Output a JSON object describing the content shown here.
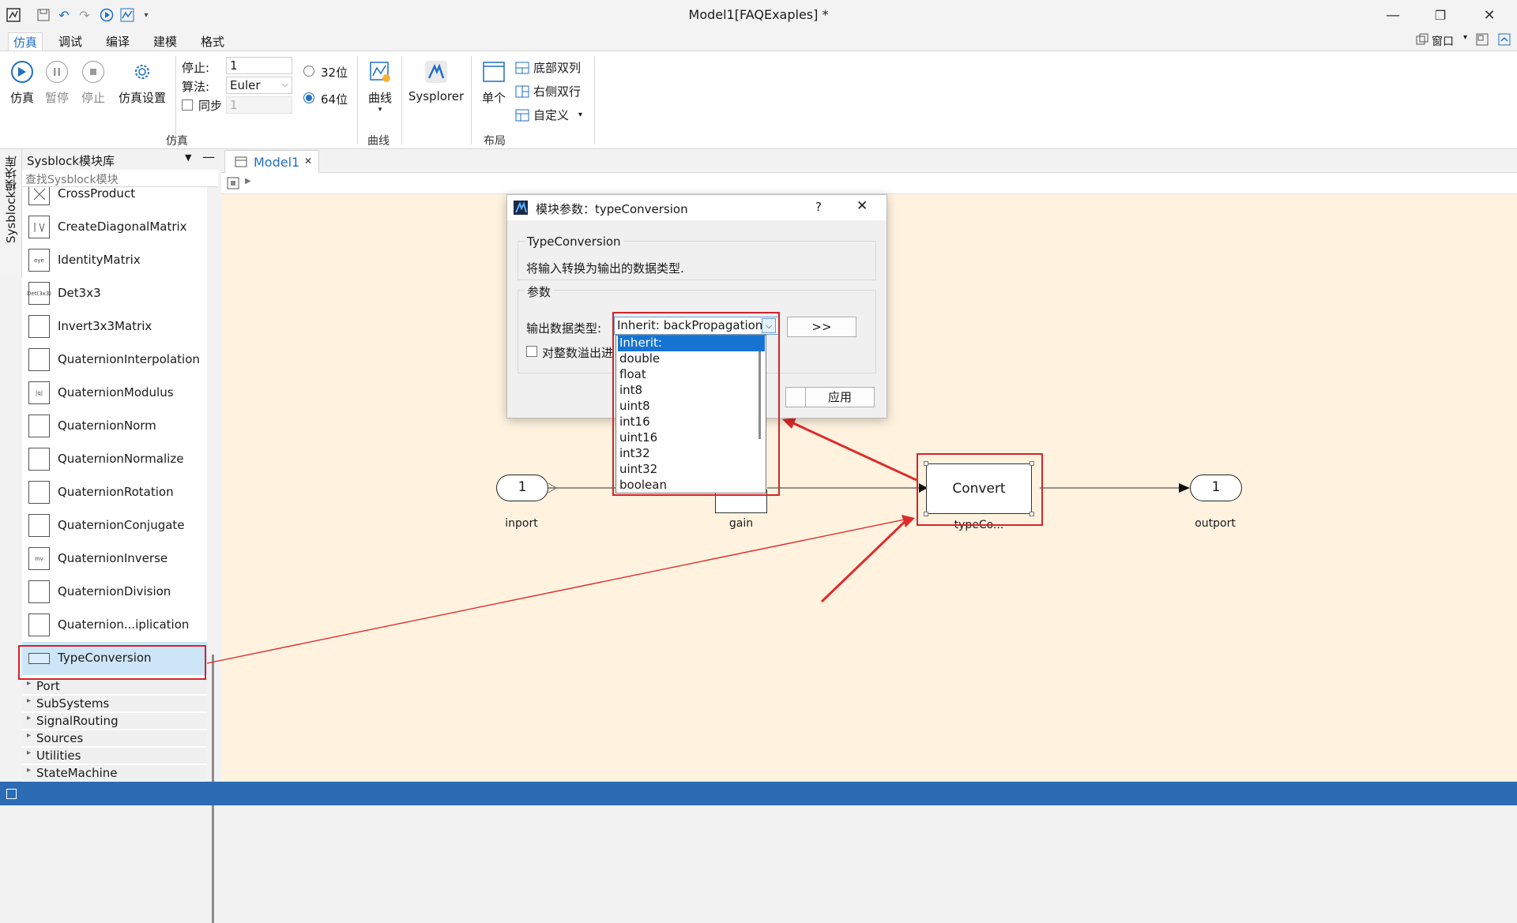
{
  "window": {
    "title": "Model1[FAQExaples] *",
    "layout_label": "窗口"
  },
  "menu": {
    "tabs": [
      "仿真",
      "调试",
      "编译",
      "建模",
      "格式"
    ],
    "active": "仿真"
  },
  "ribbon": {
    "simulate": "仿真",
    "pause": "暂停",
    "stop": "停止",
    "settings": "仿真设置",
    "stop_time_label": "停止:",
    "stop_time_value": "1",
    "algorithm_label": "算法:",
    "algorithm_value": "Euler",
    "sync_label": "同步",
    "sync_value": "1",
    "bits32": "32位",
    "bits64": "64位",
    "curve": "曲线",
    "sysplorer": "Sysplorer",
    "single": "单个",
    "bottom_dual": "底部双列",
    "right_dual": "右侧双行",
    "custom": "自定义",
    "group_sim": "仿真",
    "group_curve": "曲线",
    "group_layout": "布局"
  },
  "library": {
    "side_tab": "Sysblock模块库",
    "title": "Sysblock模块库",
    "search_placeholder": "查找Sysblock模块",
    "items": [
      {
        "name": "CrossProduct",
        "icon": ""
      },
      {
        "name": "CreateDiagonalMatrix",
        "icon": ""
      },
      {
        "name": "IdentityMatrix",
        "icon": "eye"
      },
      {
        "name": "Det3x3",
        "icon": "Det(3x3)"
      },
      {
        "name": "Invert3x3Matrix",
        "icon": ""
      },
      {
        "name": "QuaternionInterpolation",
        "icon": ""
      },
      {
        "name": "QuaternionModulus",
        "icon": "|q|"
      },
      {
        "name": "QuaternionNorm",
        "icon": ""
      },
      {
        "name": "QuaternionNormalize",
        "icon": ""
      },
      {
        "name": "QuaternionRotation",
        "icon": ""
      },
      {
        "name": "QuaternionConjugate",
        "icon": ""
      },
      {
        "name": "QuaternionInverse",
        "icon": "Inv"
      },
      {
        "name": "QuaternionDivision",
        "icon": ""
      },
      {
        "name": "Quaternion...iplication",
        "icon": ""
      },
      {
        "name": "TypeConversion",
        "icon": ""
      }
    ],
    "categories": [
      "Port",
      "SubSystems",
      "SignalRouting",
      "Sources",
      "Utilities",
      "StateMachine"
    ]
  },
  "editor": {
    "tab": "Model1"
  },
  "diagram": {
    "inport_value": "1",
    "inport_label": "inport",
    "gain_label": "gain",
    "convert_text": "Convert",
    "convert_label": "typeCo...",
    "outport_value": "1",
    "outport_label": "outport"
  },
  "dialog": {
    "title": "模块参数：typeConversion",
    "help": "?",
    "block_name": "TypeConversion",
    "description": "将输入转换为输出的数据类型.",
    "params_group": "参数",
    "output_type_label": "输出数据类型:",
    "output_type_value": "Inherit: backPropagation",
    "more_button": ">>",
    "overflow_label": "对整数溢出进",
    "apply_button": "应用",
    "options": [
      "Inherit: backPropagation",
      "double",
      "float",
      "int8",
      "uint8",
      "int16",
      "uint16",
      "int32",
      "uint32",
      "boolean"
    ],
    "selected_option": 0
  },
  "colors": {
    "accent": "#1f6fc5",
    "canvas_bg": "#fff3e0",
    "highlight_red": "#d6232a",
    "selection": "#1673d1",
    "statusbar": "#2c6cb4"
  }
}
